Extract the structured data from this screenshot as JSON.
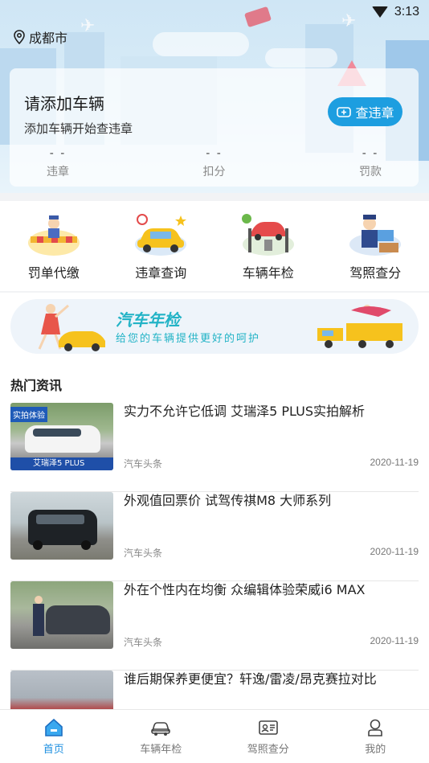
{
  "status_bar": {
    "time": "3:13"
  },
  "location": {
    "city": "成都市"
  },
  "vehicle_card": {
    "title": "请添加车辆",
    "subtitle": "添加车辆开始查违章",
    "check_button": "查违章",
    "stats": [
      {
        "value": "- -",
        "label": "违章"
      },
      {
        "value": "- -",
        "label": "扣分"
      },
      {
        "value": "- -",
        "label": "罚款"
      }
    ]
  },
  "quick_menu": [
    {
      "label": "罚单代缴",
      "icon": "police-barrier-icon"
    },
    {
      "label": "违章查询",
      "icon": "yellow-car-icon"
    },
    {
      "label": "车辆年检",
      "icon": "car-lift-icon"
    },
    {
      "label": "驾照查分",
      "icon": "officer-desk-icon"
    }
  ],
  "banner": {
    "title": "汽车年检",
    "subtitle": "给您的车辆提供更好的呵护"
  },
  "news": {
    "heading": "热门资讯",
    "items": [
      {
        "title": "实力不允许它低调 艾瑞泽5 PLUS实拍解析",
        "source": "汽车头条",
        "date": "2020-11-19",
        "thumb_tag": "实拍体验",
        "thumb_caption": "艾瑞泽5 PLUS"
      },
      {
        "title": "外观值回票价 试驾传祺M8 大师系列",
        "source": "汽车头条",
        "date": "2020-11-19"
      },
      {
        "title": "外在个性内在均衡 众编辑体验荣威i6 MAX",
        "source": "汽车头条",
        "date": "2020-11-19"
      },
      {
        "title": "谁后期保养更便宜？轩逸/雷凌/昂克赛拉对比",
        "source": "",
        "date": ""
      }
    ]
  },
  "tabbar": [
    {
      "label": "首页",
      "icon": "home-icon",
      "active": true
    },
    {
      "label": "车辆年检",
      "icon": "car-icon",
      "active": false
    },
    {
      "label": "驾照查分",
      "icon": "id-card-icon",
      "active": false
    },
    {
      "label": "我的",
      "icon": "user-icon",
      "active": false
    }
  ],
  "colors": {
    "accent": "#1d9ee0",
    "active_tab": "#1d8fe0",
    "banner_text": "#22b3c6"
  }
}
